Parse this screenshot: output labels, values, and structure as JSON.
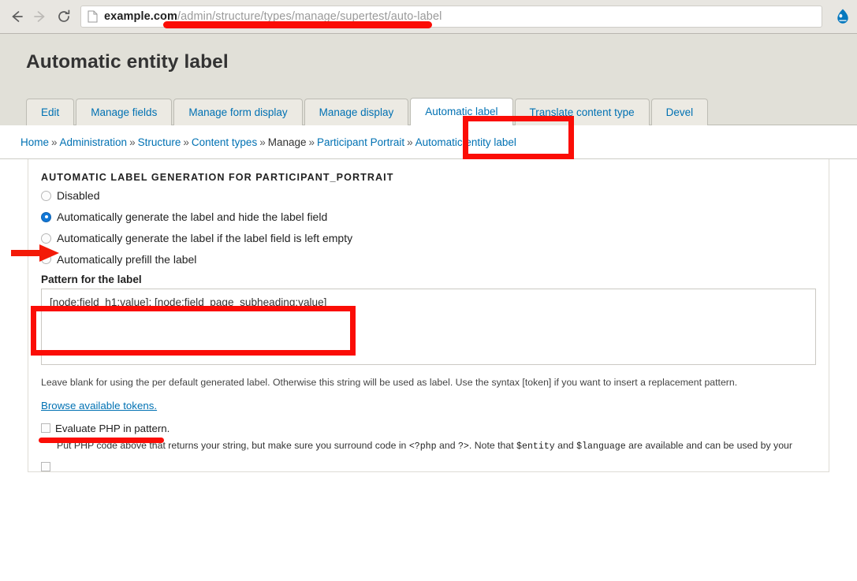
{
  "browser": {
    "back_icon": "arrow-left-icon",
    "forward_icon": "arrow-right-icon",
    "reload_icon": "reload-icon",
    "page_icon": "page-document-icon",
    "url_domain": "example.com",
    "url_path": "/admin/structure/types/manage/supertest/auto-label",
    "url_full": "example.com/admin/structure/types/manage/supertest/auto-label",
    "extension_icon": "drupal-droplet-icon"
  },
  "page": {
    "title": "Automatic entity label"
  },
  "tabs": [
    {
      "label": "Edit",
      "active": false
    },
    {
      "label": "Manage fields",
      "active": false
    },
    {
      "label": "Manage form display",
      "active": false
    },
    {
      "label": "Manage display",
      "active": false
    },
    {
      "label": "Automatic label",
      "active": true
    },
    {
      "label": "Translate content type",
      "active": false
    },
    {
      "label": "Devel",
      "active": false
    }
  ],
  "breadcrumb": {
    "separator": "»",
    "items": [
      {
        "label": "Home",
        "link": true
      },
      {
        "label": "Administration",
        "link": true
      },
      {
        "label": "Structure",
        "link": true
      },
      {
        "label": "Content types",
        "link": true
      },
      {
        "label": "Manage",
        "link": false
      },
      {
        "label": "Participant Portrait",
        "link": true
      },
      {
        "label": "Automatic entity label",
        "link": true
      }
    ]
  },
  "form": {
    "legend": "AUTOMATIC LABEL GENERATION FOR PARTICIPANT_PORTRAIT",
    "radios": [
      {
        "label": "Disabled",
        "checked": false
      },
      {
        "label": "Automatically generate the label and hide the label field",
        "checked": true
      },
      {
        "label": "Automatically generate the label if the label field is left empty",
        "checked": false
      },
      {
        "label": "Automatically prefill the label",
        "checked": false
      }
    ],
    "pattern": {
      "label": "Pattern for the label",
      "value": "[node:field_h1:value]: [node:field_page_subheading:value]",
      "placeholder": ""
    },
    "help_text": "Leave blank for using the per default generated label. Otherwise this string will be used as label. Use the syntax [token] if you want to insert a replacement pattern.",
    "token_link": "Browse available tokens.",
    "php_checkbox": {
      "label": "Evaluate PHP in pattern.",
      "checked": false
    },
    "php_help_prefix": "Put PHP code above that returns your string, but make sure you surround code in ",
    "php_help_code1": "<?php",
    "php_help_mid1": " and ",
    "php_help_code2": "?>",
    "php_help_mid2": ". Note that ",
    "php_help_code3": "$entity",
    "php_help_mid3": " and ",
    "php_help_code4": "$language",
    "php_help_suffix": " are available and can be used by your"
  },
  "annotations": {
    "accent_color": "#fb0d06",
    "url_underline": "red-underline-annotation",
    "tab_box": "red-box-annotation-active-tab",
    "pattern_box": "red-box-annotation-pattern-field",
    "arrow": "red-arrow-annotation",
    "token_underline": "red-underline-annotation-tokens"
  }
}
